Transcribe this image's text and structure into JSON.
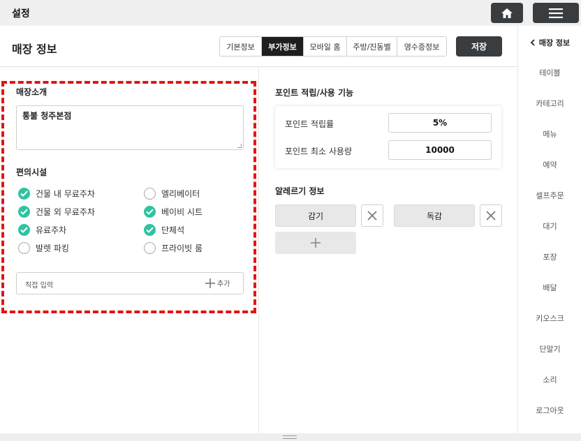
{
  "app": {
    "title": "설정"
  },
  "header": {
    "page_title": "매장 정보",
    "tabs": [
      {
        "label": "기본정보",
        "active": false
      },
      {
        "label": "부가정보",
        "active": true
      },
      {
        "label": "모바일 홈",
        "active": false
      },
      {
        "label": "주방/진동벨",
        "active": false
      },
      {
        "label": "영수증정보",
        "active": false
      }
    ],
    "save_label": "저장"
  },
  "left": {
    "intro_label": "매장소개",
    "intro_value": "통불 청주본점",
    "facility_label": "편의시설",
    "facilities": [
      {
        "label": "건물 내 무료주차",
        "checked": true
      },
      {
        "label": "엘리베이터",
        "checked": false
      },
      {
        "label": "건물 외 무료주차",
        "checked": true
      },
      {
        "label": "베이비 시트",
        "checked": true
      },
      {
        "label": "유료주차",
        "checked": true
      },
      {
        "label": "단체석",
        "checked": true
      },
      {
        "label": "발렛 파킹",
        "checked": false
      },
      {
        "label": "프라이빗 룸",
        "checked": false
      }
    ],
    "direct_input_placeholder": "직접 입력",
    "add_label": "추가"
  },
  "right": {
    "point_label": "포인트 적립/사용 기능",
    "point_rate_label": "포인트 적립률",
    "point_rate_value": "5%",
    "point_min_label": "포인트 최소 사용량",
    "point_min_value": "10000",
    "allergy_label": "알레르기 정보",
    "allergies": [
      "감기",
      "독감"
    ]
  },
  "sidebar": {
    "items": [
      {
        "label": "매장 정보",
        "active": true
      },
      {
        "label": "테이블",
        "active": false
      },
      {
        "label": "카테고리",
        "active": false
      },
      {
        "label": "메뉴",
        "active": false
      },
      {
        "label": "예약",
        "active": false
      },
      {
        "label": "셀프주문",
        "active": false
      },
      {
        "label": "대기",
        "active": false
      },
      {
        "label": "포장",
        "active": false
      },
      {
        "label": "배달",
        "active": false
      },
      {
        "label": "키오스크",
        "active": false
      },
      {
        "label": "단말기",
        "active": false
      },
      {
        "label": "소리",
        "active": false
      },
      {
        "label": "로그아웃",
        "active": false
      }
    ]
  },
  "colors": {
    "accent_check": "#2ec4a0",
    "dark_button": "#3a3d40",
    "highlight_dash": "#e31414"
  }
}
